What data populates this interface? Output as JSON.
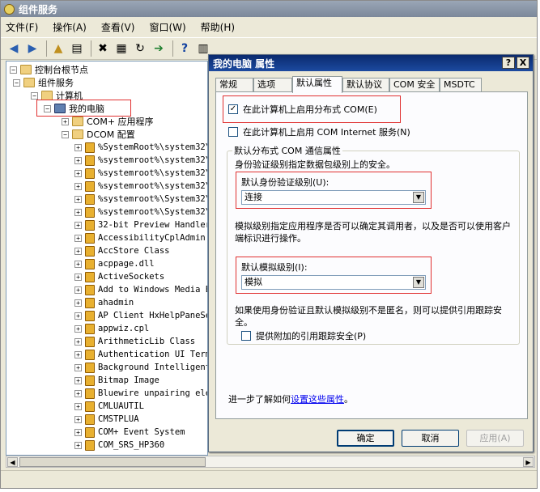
{
  "window": {
    "title": "组件服务"
  },
  "menu": [
    "文件(F)",
    "操作(A)",
    "查看(V)",
    "窗口(W)",
    "帮助(H)"
  ],
  "tree": {
    "root": "控制台根节点",
    "component_services": "组件服务",
    "computers": "计算机",
    "my_computer": "我的电脑",
    "com_apps": "COM+ 应用程序",
    "dcom_config": "DCOM 配置",
    "items": [
      "%SystemRoot%\\system32\\",
      "%systemroot%\\system32\\",
      "%systemroot%\\system32\\",
      "%systemroot%\\system32\\",
      "%systemroot%\\System32\\",
      "%systemroot%\\System32\\",
      "32-bit Preview Handler",
      "AccessibilityCplAdmin",
      "AccStore Class",
      "acppage.dll",
      "ActiveSockets",
      "Add to Windows Media E",
      "ahadmin",
      "AP Client HxHelpPaneSe",
      "appwiz.cpl",
      "ArithmeticLib Class",
      "Authentication UI Term",
      "Background Intelligent",
      "Bitmap Image",
      "Bluewire unpairing ele",
      "CMLUAUTIL",
      "CMSTPLUA",
      "COM+ Event System",
      "COM_SRS_HP360"
    ]
  },
  "dialog": {
    "title": "我的电脑 属性",
    "help_btn": "?",
    "close_btn": "X",
    "tabs": [
      "常规",
      "选项",
      "默认属性",
      "默认协议",
      "COM 安全",
      "MSDTC"
    ],
    "enable_dcom": "在此计算机上启用分布式 COM(E)",
    "enable_internet": "在此计算机上启用 COM Internet 服务(N)",
    "group_title": "默认分布式 COM 通信属性",
    "auth_desc": "身份验证级别指定数据包级别上的安全。",
    "auth_label": "默认身份验证级别(U):",
    "auth_value": "连接",
    "imp_desc": "模拟级别指定应用程序是否可以确定其调用者，以及是否可以使用客户端标识进行操作。",
    "imp_label": "默认模拟级别(I):",
    "imp_value": "模拟",
    "ref_desc": "如果使用身份验证且默认模拟级别不是匿名，则可以提供引用跟踪安全。",
    "ref_check": "提供附加的引用跟踪安全(P)",
    "learn_prefix": "进一步了解如何",
    "learn_link": "设置这些属性",
    "learn_suffix": "。",
    "ok": "确定",
    "cancel": "取消",
    "apply": "应用(A)"
  }
}
